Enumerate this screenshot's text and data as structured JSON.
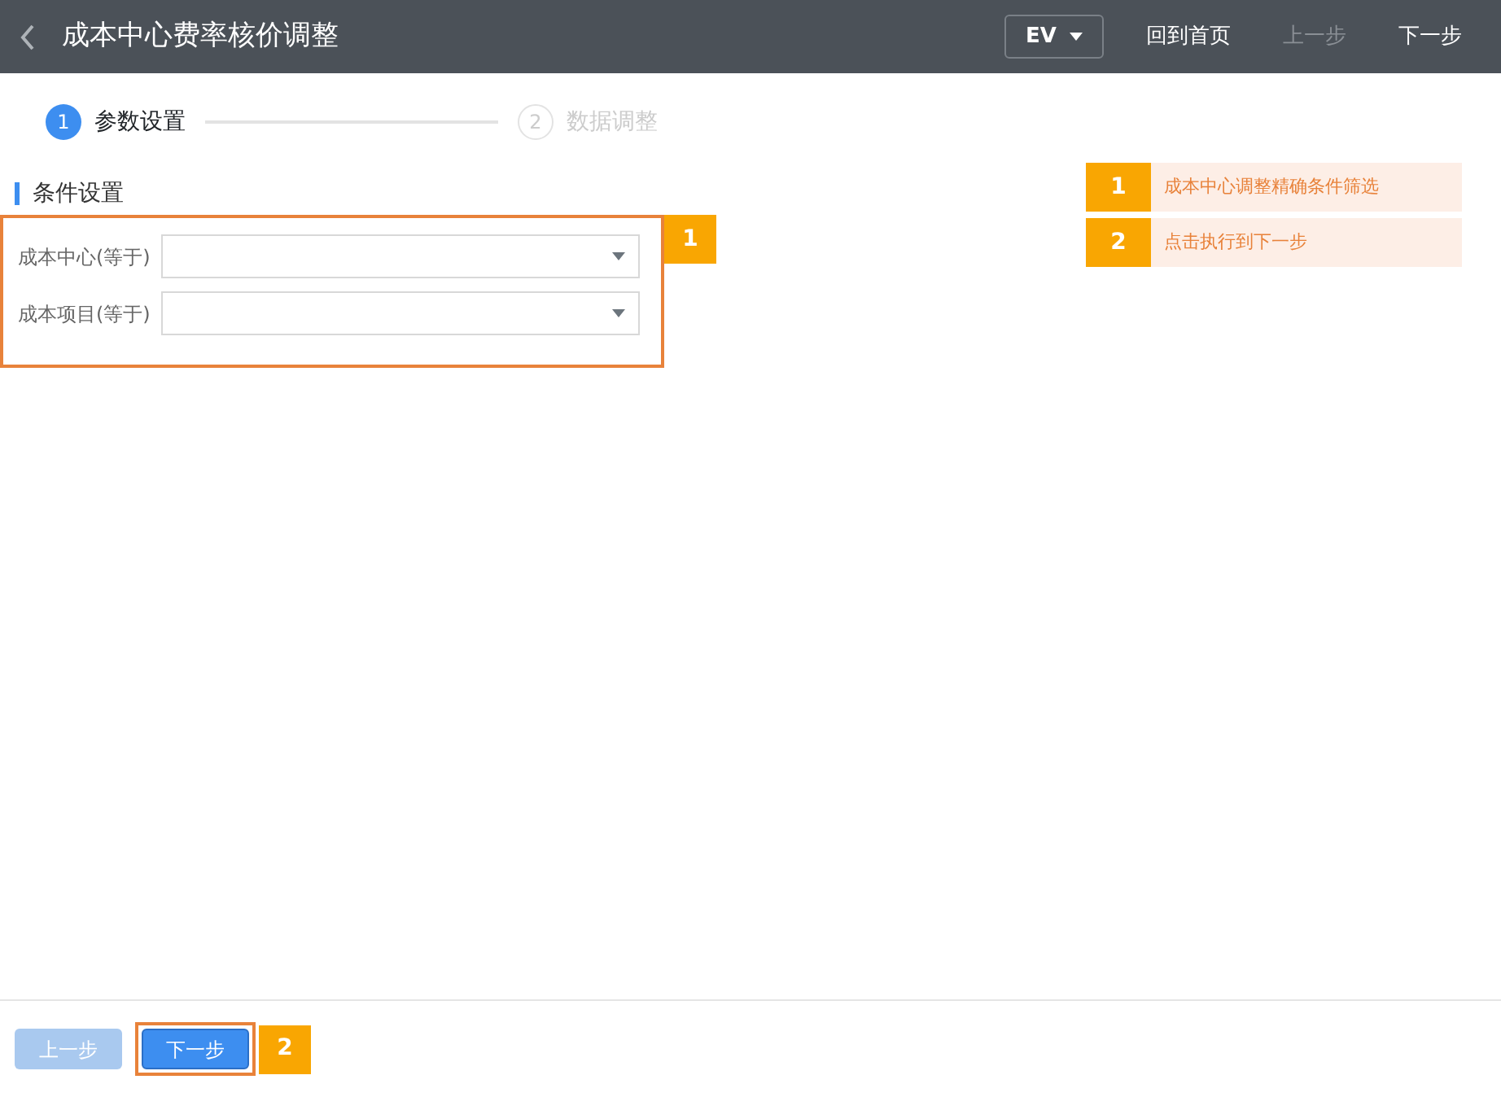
{
  "header": {
    "title": "成本中心费率核价调整",
    "language": "EV",
    "actions": [
      {
        "label": "回到首页",
        "disabled": false
      },
      {
        "label": "上一步",
        "disabled": true
      },
      {
        "label": "下一步",
        "disabled": false
      }
    ]
  },
  "steps": [
    {
      "number": "1",
      "label": "参数设置",
      "selected": true
    },
    {
      "number": "2",
      "label": "数据调整",
      "selected": false
    }
  ],
  "section": {
    "title": "条件设置",
    "marker": "1",
    "fields": [
      {
        "label": "成本中心(等于)"
      },
      {
        "label": "成本项目(等于)"
      }
    ]
  },
  "legend": [
    {
      "number": "1",
      "text": "成本中心调整精确条件筛选"
    },
    {
      "number": "2",
      "text": "点击执行到下一步"
    }
  ],
  "footer": {
    "marker": "2",
    "buttons": [
      {
        "label": "上一步",
        "disabled": true,
        "highlighted": false
      },
      {
        "label": "下一步",
        "disabled": false,
        "highlighted": true
      }
    ]
  }
}
